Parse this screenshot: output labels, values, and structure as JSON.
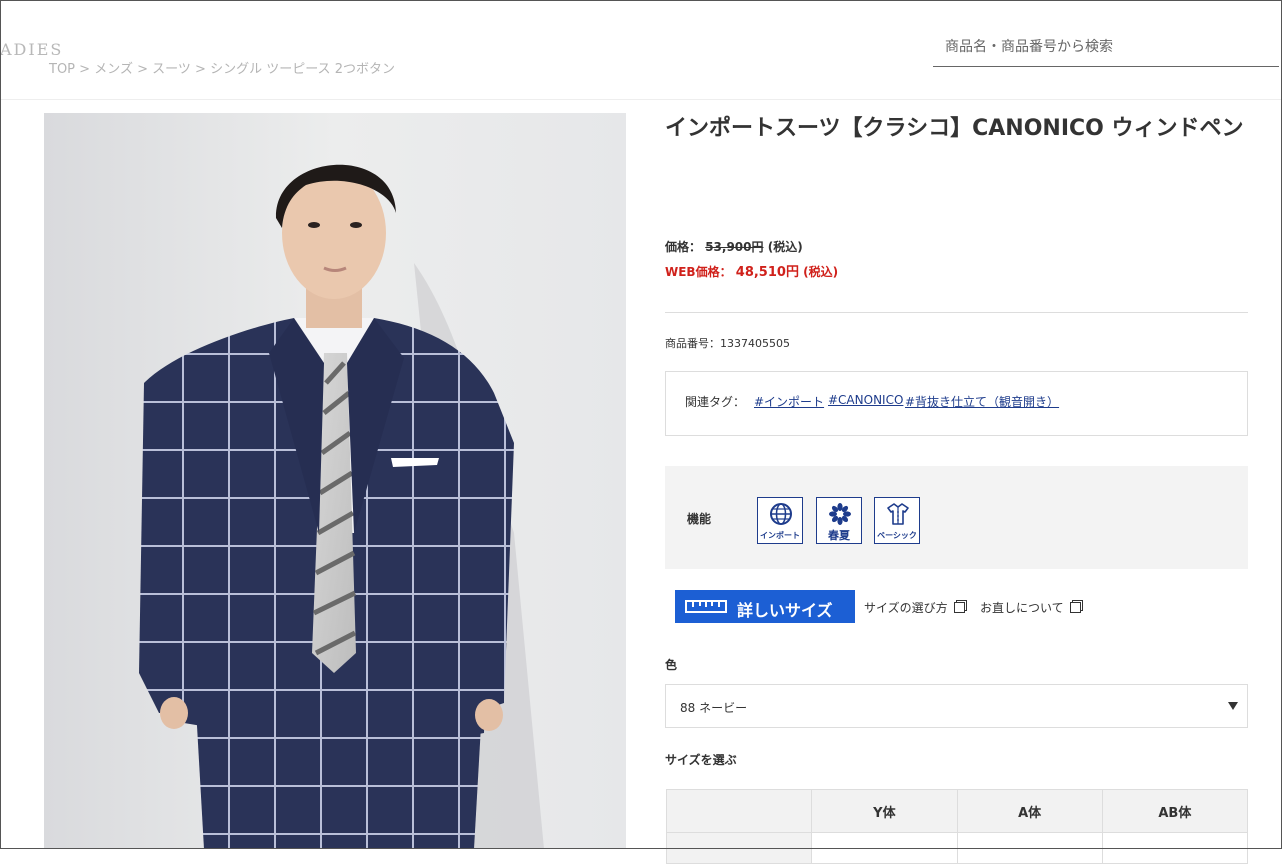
{
  "header": {
    "brand": "ADIES",
    "breadcrumb": [
      "TOP",
      "メンズ",
      "スーツ",
      "シングル ツーピース 2つボタン"
    ],
    "breadcrumb_sep": ">",
    "search_placeholder": "商品名・商品番号から検索"
  },
  "product": {
    "title": "インポートスーツ【クラシコ】CANONICO ウィンドペン",
    "price_label": "価格：",
    "price_original": "53,900円",
    "tax_label": "(税込)",
    "web_price_label": "WEB価格：",
    "web_price": "48,510円",
    "web_tax_label": "(税込)",
    "product_number": "商品番号：1337405505",
    "tags_label": "関連タグ：",
    "tags": [
      "#インポート",
      "#CANONICO",
      "#背抜き仕立て（観音開き）"
    ],
    "feature_label": "機能",
    "features": [
      {
        "label": "インポート",
        "icon": "globe-icon"
      },
      {
        "label": "春夏",
        "icon": "flower-icon"
      },
      {
        "label": "ベーシック",
        "icon": "shirt-icon"
      }
    ],
    "size_button": "詳しいサイズ",
    "size_guide_link": "サイズの選び方",
    "alteration_link": "お直しについて",
    "color_label": "色",
    "color_selected": "88 ネービー",
    "size_label": "サイズを選ぶ",
    "size_table_headers": [
      "",
      "Y体",
      "A体",
      "AB体"
    ]
  },
  "colors": {
    "accent_blue": "#1c5fd4",
    "navy": "#1e3c8c",
    "sale_red": "#d0211b"
  }
}
